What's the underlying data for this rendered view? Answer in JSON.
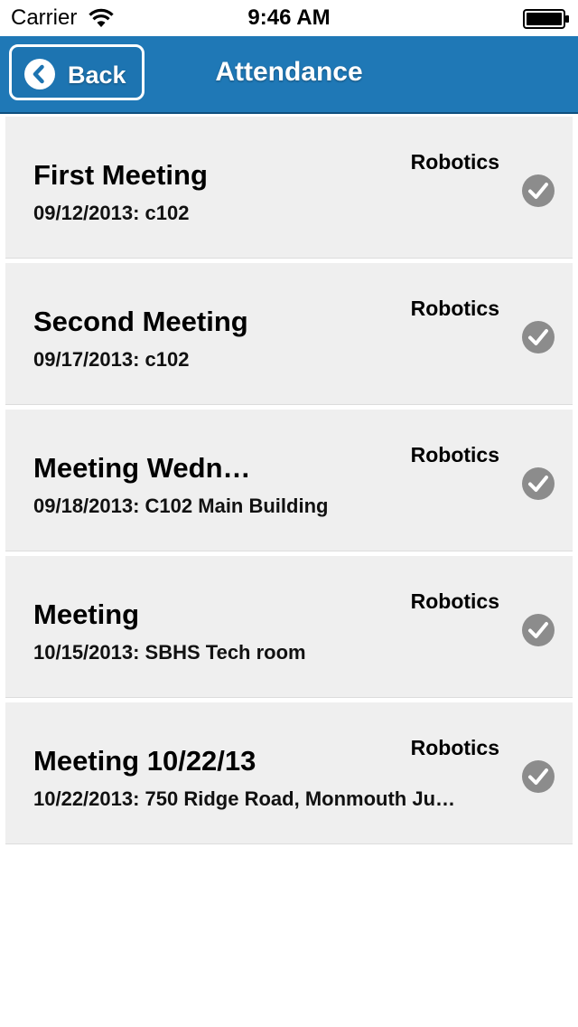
{
  "status_bar": {
    "carrier": "Carrier",
    "time": "9:46 AM"
  },
  "nav": {
    "back_label": "Back",
    "title": "Attendance"
  },
  "icons": {
    "wifi": "wifi-icon",
    "battery": "battery-icon",
    "back": "chevron-left-icon",
    "check": "checkmark-circle-icon"
  },
  "colors": {
    "nav_background": "#1f78b6",
    "row_background": "#efefef",
    "check_color": "#8c8c8c"
  },
  "meetings": [
    {
      "title": "First Meeting",
      "subtitle": "09/12/2013: c102",
      "group": "Robotics"
    },
    {
      "title": "Second Meeting",
      "subtitle": "09/17/2013: c102",
      "group": "Robotics"
    },
    {
      "title": "Meeting Wedn…",
      "subtitle": "09/18/2013: C102 Main Building",
      "group": "Robotics"
    },
    {
      "title": "Meeting",
      "subtitle": "10/15/2013: SBHS Tech room",
      "group": "Robotics"
    },
    {
      "title": "Meeting 10/22/13",
      "subtitle": "10/22/2013: 750 Ridge Road, Monmouth Ju…",
      "group": "Robotics"
    }
  ]
}
